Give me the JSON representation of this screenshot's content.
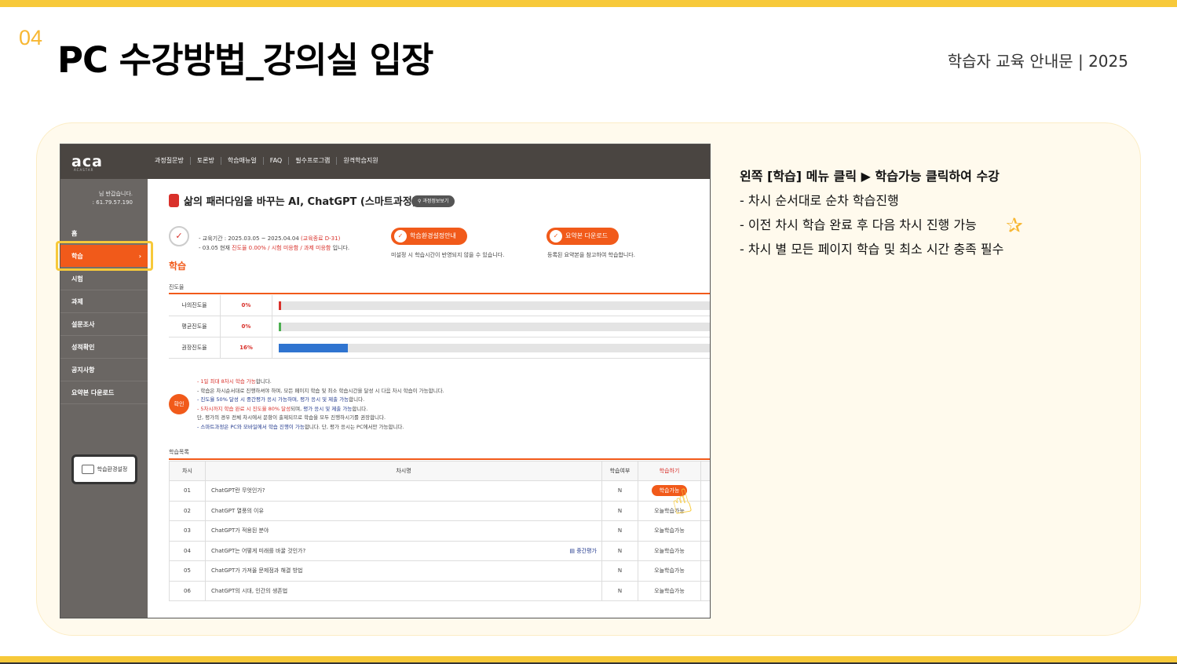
{
  "slide": {
    "number": "04",
    "title": "PC 수강방법_강의실 입장",
    "subtitle": "학습자 교육 안내문 | 2025"
  },
  "screenshot": {
    "logo": "aca",
    "logo_sub": "ACASTAR",
    "nav": [
      "과정질문방",
      "토론방",
      "학습매뉴얼",
      "FAQ",
      "필수프로그램",
      "원격학습지원"
    ],
    "greeting": [
      "님 반갑습니다.",
      ": 61.79.57.190"
    ],
    "side_menu": [
      "홈",
      "학습",
      "시험",
      "과제",
      "설문조사",
      "성적확인",
      "공지사항",
      "요약본 다운로드"
    ],
    "env_button": "학습환경설정",
    "course_title": "삶의 패러다임을 바꾸는 AI, ChatGPT (스마트과정)",
    "course_info_button": "과정정보보기",
    "period_line1_a": "- 교육기간 : 2025.03.05 ~ 2025.04.04 ",
    "period_line1_b": "(교육종료 D-31)",
    "period_line2_a": "- 03.05 현재 ",
    "period_line2_b": "진도율 0.00% / 시험 미응함 / 과제 미응함",
    "period_line2_c": " 입니다.",
    "env_guide_button": "학습환경설정안내",
    "env_guide_note": "미설정 시 학습시간이 반영되지 않을 수 있습니다.",
    "summary_button": "요약본 다운로드",
    "summary_note": "등록된 요약본을 참고하여 학습합니다.",
    "learn_title": "학습",
    "progress_label": "진도율",
    "progress_rows": [
      {
        "label": "나의진도율",
        "pct": "0%",
        "value": 0,
        "color": "#d9312b"
      },
      {
        "label": "평균진도율",
        "pct": "0%",
        "value": 0,
        "color": "#4caf50"
      },
      {
        "label": "권장진도율",
        "pct": "16%",
        "value": 16,
        "color": "#2f74d0"
      }
    ],
    "notice_badge": "확인",
    "notice": [
      {
        "parts": [
          {
            "t": "- 1일 최대 8차시 학습 가능",
            "c": "r"
          },
          {
            "t": "합니다.",
            "c": ""
          }
        ]
      },
      {
        "parts": [
          {
            "t": "- 학습은 차시순서대로 진행하셔야 하며, 모든 페이지 학습 및 최소 학습시간을 달성 시 다음 차시 학습이 가능합니다.",
            "c": ""
          }
        ]
      },
      {
        "parts": [
          {
            "t": "- 진도율 50% 달성 시 중간평가 응시 가능하며, 평가 응시 및 제출 가능",
            "c": "b"
          },
          {
            "t": "합니다.",
            "c": ""
          }
        ]
      },
      {
        "parts": [
          {
            "t": "- 5차시까지 학습 완료 시 진도율 80% 달성",
            "c": "r"
          },
          {
            "t": "되며, ",
            "c": ""
          },
          {
            "t": "평가 응시 및 제출 가능",
            "c": "b"
          },
          {
            "t": "합니다.",
            "c": ""
          }
        ]
      },
      {
        "parts": [
          {
            "t": "단, 평가의 경우 전체 차시에서 문항이 출제되므로 학습을 모두 진행하시기를 권장합니다.",
            "c": ""
          }
        ]
      },
      {
        "parts": [
          {
            "t": "- 스마트과정은 PC와 모바일에서 학습 진행이 가능",
            "c": "b"
          },
          {
            "t": "합니다. 단, 평가 응시는 PC에서만 가능합니다.",
            "c": ""
          }
        ]
      }
    ],
    "list_label": "학습목록",
    "list_headers": [
      "차시",
      "차시명",
      "학습여부",
      "학습하기"
    ],
    "list_rows": [
      {
        "no": "01",
        "name": "ChatGPT란 무엇인가?",
        "eval": "",
        "done": "N",
        "action": "학습가능"
      },
      {
        "no": "02",
        "name": "ChatGPT 열풍의 이유",
        "eval": "",
        "done": "N",
        "action": "오늘학습가능"
      },
      {
        "no": "03",
        "name": "ChatGPT가 적용된 분야",
        "eval": "",
        "done": "N",
        "action": "오늘학습가능"
      },
      {
        "no": "04",
        "name": "ChatGPT는 어떻게 미래를 바꿀 것인가?",
        "eval": "중간평가",
        "done": "N",
        "action": "오늘학습가능"
      },
      {
        "no": "05",
        "name": "ChatGPT가 가져올 문제점과 해결 방법",
        "eval": "",
        "done": "N",
        "action": "오늘학습가능"
      },
      {
        "no": "06",
        "name": "ChatGPT의 시대, 인간의 생존법",
        "eval": "",
        "done": "N",
        "action": "오늘학습가능"
      }
    ]
  },
  "instructions": {
    "head": "왼쪽 [학습] 메뉴 클릭 ▶ 학습가능 클릭하여 수강",
    "items": [
      "- 차시 순서대로 순차 학습진행",
      "- 이전 차시 학습 완료 후 다음 차시 진행 가능",
      "- 차시 별 모든 페이지 학습 및 최소 시간 충족 필수"
    ]
  },
  "colors": {
    "accent": "#f7c93a",
    "orange": "#f15a1a",
    "red": "#d9312b",
    "navy": "#243b8f"
  }
}
